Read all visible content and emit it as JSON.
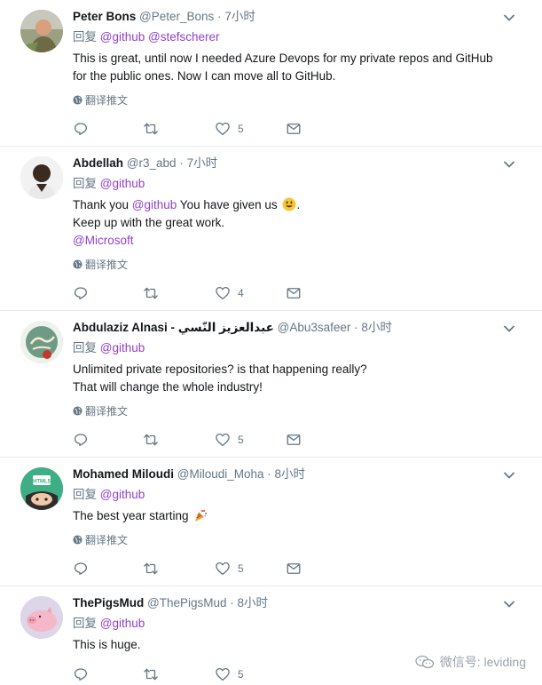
{
  "tweets": [
    {
      "name": "Peter Bons",
      "handle": "@Peter_Bons",
      "dot": "·",
      "time": "7小时",
      "reply_prefix": "回复",
      "mentions": [
        "@github",
        "@stefscherer"
      ],
      "lines": [
        "This is great, until now I needed Azure Devops for my private repos and GitHub",
        "for the public ones. Now I can move all to GitHub."
      ],
      "translate": "翻译推文",
      "likes": "5",
      "avatar_icon": "photo-avatar"
    },
    {
      "name": "Abdellah",
      "handle": "@r3_abd",
      "dot": "·",
      "time": "7小时",
      "reply_prefix": "回复",
      "mentions": [
        "@github"
      ],
      "line1_pre": "Thank you ",
      "line1_mention": "@github",
      "line1_post": " You have given us",
      "line1_post2": ".",
      "line2": "Keep up with the great work.",
      "line3_mention": "@Microsoft",
      "translate": "翻译推文",
      "likes": "4",
      "avatar_icon": "person-avatar",
      "emoji_icon": "smiley-emoji-icon"
    },
    {
      "name": "Abdulaziz Alnasi - عبدالعزيز النّسي",
      "handle": "@Abu3safeer",
      "dot": "·",
      "time": "8小时",
      "reply_prefix": "回复",
      "mentions": [
        "@github"
      ],
      "lines": [
        "Unlimited private repositories? is that happening really?",
        "That will change the whole industry!"
      ],
      "translate": "翻译推文",
      "likes": "5",
      "avatar_icon": "calligraphy-avatar"
    },
    {
      "name": "Mohamed Miloudi",
      "handle": "@Miloudi_Moha",
      "dot": "·",
      "time": "8小时",
      "reply_prefix": "回复",
      "mentions": [
        "@github"
      ],
      "line1_pre": "The best year starting",
      "translate": "翻译推文",
      "likes": "5",
      "avatar_icon": "html5-avatar",
      "emoji_icon": "party-popper-emoji-icon"
    },
    {
      "name": "ThePigsMud",
      "handle": "@ThePigsMud",
      "dot": "·",
      "time": "8小时",
      "reply_prefix": "回复",
      "mentions": [
        "@github"
      ],
      "lines": [
        "This is huge."
      ],
      "likes": "5",
      "avatar_icon": "pig-avatar"
    }
  ],
  "watermark": {
    "text": "微信号: leviding",
    "icon": "wechat-icon"
  },
  "icons": {
    "reply": "reply-icon",
    "retweet": "retweet-icon",
    "like": "heart-icon",
    "dm": "envelope-icon",
    "caret": "chevron-down-icon",
    "globe": "globe-icon"
  },
  "colors": {
    "mention": "#9141cc",
    "secondary_text": "#657786",
    "primary_text": "#14171a",
    "divider": "#e6ecf0"
  }
}
